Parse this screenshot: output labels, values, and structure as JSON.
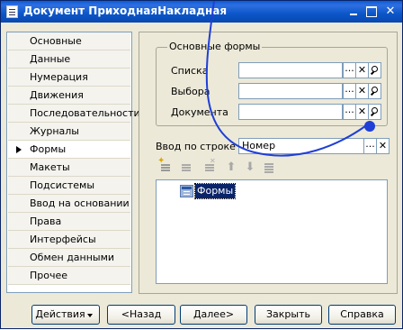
{
  "window": {
    "title": "Документ ПриходнаяНакладная",
    "minimize_label": "_",
    "maximize_label": "",
    "close_label": "✕"
  },
  "nav": {
    "items": [
      {
        "label": "Основные"
      },
      {
        "label": "Данные"
      },
      {
        "label": "Нумерация"
      },
      {
        "label": "Движения"
      },
      {
        "label": "Последовательности"
      },
      {
        "label": "Журналы"
      },
      {
        "label": "Формы"
      },
      {
        "label": "Макеты"
      },
      {
        "label": "Подсистемы"
      },
      {
        "label": "Ввод на основании"
      },
      {
        "label": "Права"
      },
      {
        "label": "Интерфейсы"
      },
      {
        "label": "Обмен данными"
      },
      {
        "label": "Прочее"
      }
    ],
    "active_index": 6
  },
  "forms_group": {
    "legend": "Основные формы",
    "fields": [
      {
        "label": "Списка",
        "value": ""
      },
      {
        "label": "Выбора",
        "value": ""
      },
      {
        "label": "Документа",
        "value": ""
      }
    ],
    "ellipsis_label": "...",
    "clear_label": "✕"
  },
  "input_by_line": {
    "label": "Ввод по строке",
    "value": "Номер"
  },
  "tree": {
    "items": [
      {
        "label": "Формы"
      }
    ]
  },
  "toolbar": {
    "up_glyph": "⬆",
    "down_glyph": "⬇"
  },
  "buttons": {
    "actions": "Действия",
    "back": "<Назад",
    "next": "Далее>",
    "close": "Закрыть",
    "help": "Справка"
  },
  "colors": {
    "annotation_arrow": "#1f3fd6",
    "title_bar": "#0a5bd8",
    "selection": "#0a246a"
  }
}
